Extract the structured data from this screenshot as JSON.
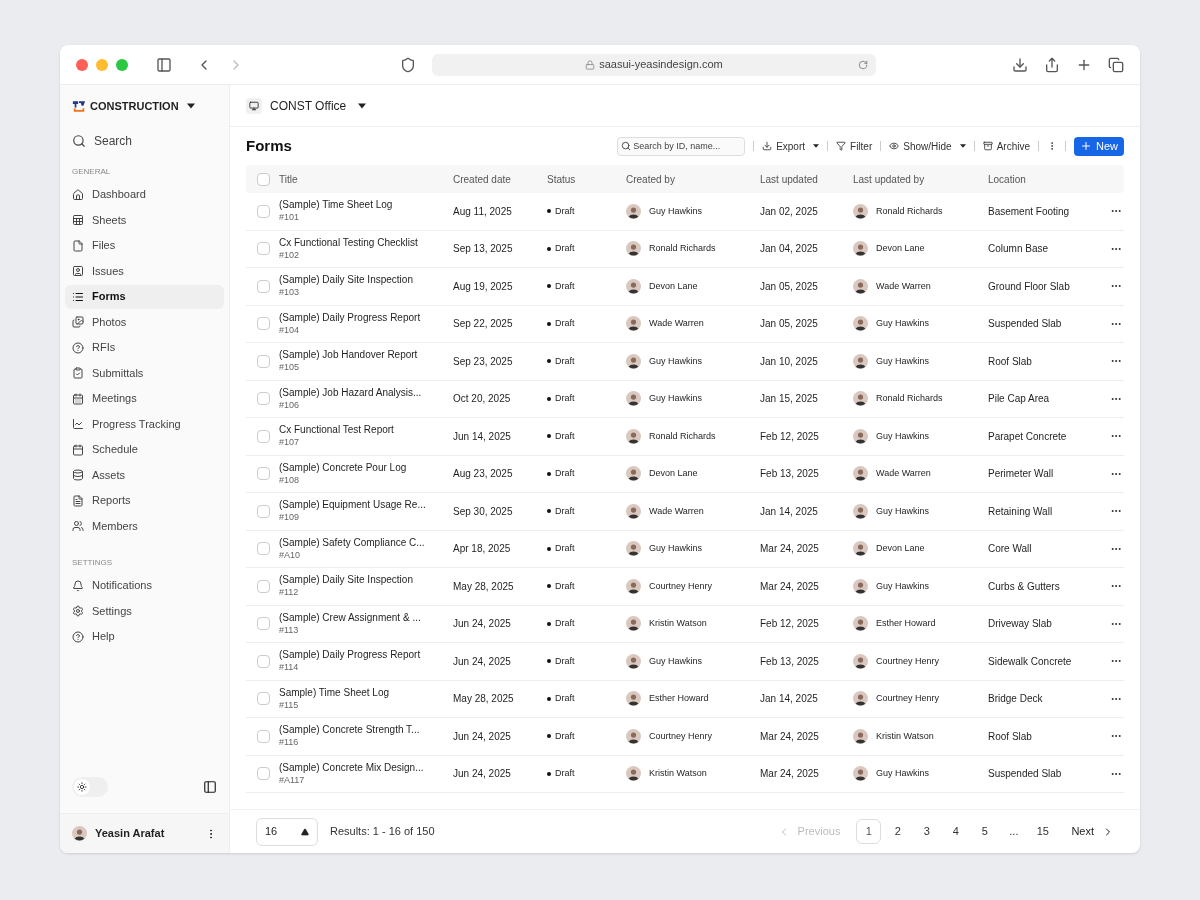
{
  "browser": {
    "url": "saasui-yeasindesign.com"
  },
  "sidebar": {
    "brand": "CONSTRUCTION",
    "search": "Search",
    "sections": [
      {
        "heading": "GENERAL",
        "items": [
          {
            "label": "Dashboard",
            "selected": false
          },
          {
            "label": "Sheets",
            "selected": false
          },
          {
            "label": "Files",
            "selected": false
          },
          {
            "label": "Issues",
            "selected": false
          },
          {
            "label": "Forms",
            "selected": true
          },
          {
            "label": "Photos",
            "selected": false
          },
          {
            "label": "RFIs",
            "selected": false
          },
          {
            "label": "Submittals",
            "selected": false
          },
          {
            "label": "Meetings",
            "selected": false
          },
          {
            "label": "Progress Tracking",
            "selected": false
          },
          {
            "label": "Schedule",
            "selected": false
          },
          {
            "label": "Assets",
            "selected": false
          },
          {
            "label": "Reports",
            "selected": false
          },
          {
            "label": "Members",
            "selected": false
          }
        ]
      },
      {
        "heading": "SETTINGS",
        "items": [
          {
            "label": "Notifications",
            "selected": false
          },
          {
            "label": "Settings",
            "selected": false
          },
          {
            "label": "Help",
            "selected": false
          }
        ]
      }
    ],
    "dark_mode": false,
    "user": "Yeasin Arafat"
  },
  "workspace": "CONST Office",
  "page_title": "Forms",
  "toolbar": {
    "search_placeholder": "Search by ID, name...",
    "export": "Export",
    "filter": "Filter",
    "show_hide": "Show/Hide",
    "archive": "Archive",
    "new": "New"
  },
  "table": {
    "all_selected": false,
    "columns": [
      "Title",
      "Created date",
      "Status",
      "Created by",
      "Last updated",
      "Last updated by",
      "Location"
    ],
    "rows": [
      {
        "title": "(Sample) Time Sheet Log",
        "id": "#101",
        "created": "Aug 11, 2025",
        "status": "Draft",
        "created_by": "Guy Hawkins",
        "updated": "Jan 02, 2025",
        "updated_by": "Ronald Richards",
        "location": "Basement Footing",
        "checked": false
      },
      {
        "title": "Cx Functional Testing Checklist",
        "id": "#102",
        "created": "Sep 13, 2025",
        "status": "Draft",
        "created_by": "Ronald Richards",
        "updated": "Jan 04, 2025",
        "updated_by": "Devon Lane",
        "location": "Column Base",
        "checked": false
      },
      {
        "title": "(Sample) Daily Site Inspection",
        "id": "#103",
        "created": "Aug 19, 2025",
        "status": "Draft",
        "created_by": "Devon Lane",
        "updated": "Jan 05, 2025",
        "updated_by": "Wade Warren",
        "location": "Ground Floor Slab",
        "checked": false
      },
      {
        "title": "(Sample) Daily Progress Report",
        "id": "#104",
        "created": "Sep 22, 2025",
        "status": "Draft",
        "created_by": "Wade Warren",
        "updated": "Jan 05, 2025",
        "updated_by": "Guy Hawkins",
        "location": "Suspended Slab",
        "checked": false
      },
      {
        "title": "(Sample) Job Handover Report",
        "id": "#105",
        "created": "Sep 23, 2025",
        "status": "Draft",
        "created_by": "Guy Hawkins",
        "updated": "Jan 10, 2025",
        "updated_by": "Guy Hawkins",
        "location": "Roof Slab",
        "checked": false
      },
      {
        "title": "(Sample) Job Hazard Analysis...",
        "id": "#106",
        "created": "Oct 20, 2025",
        "status": "Draft",
        "created_by": "Guy Hawkins",
        "updated": "Jan 15, 2025",
        "updated_by": "Ronald Richards",
        "location": "Pile Cap Area",
        "checked": false
      },
      {
        "title": "Cx Functional Test Report",
        "id": "#107",
        "created": "Jun 14, 2025",
        "status": "Draft",
        "created_by": "Ronald Richards",
        "updated": "Feb 12, 2025",
        "updated_by": "Guy Hawkins",
        "location": "Parapet Concrete",
        "checked": false
      },
      {
        "title": "(Sample) Concrete Pour Log",
        "id": "#108",
        "created": "Aug 23, 2025",
        "status": "Draft",
        "created_by": "Devon Lane",
        "updated": "Feb 13, 2025",
        "updated_by": "Wade Warren",
        "location": "Perimeter Wall",
        "checked": false
      },
      {
        "title": "(Sample) Equipment Usage Re...",
        "id": "#109",
        "created": "Sep 30, 2025",
        "status": "Draft",
        "created_by": "Wade Warren",
        "updated": "Jan 14, 2025",
        "updated_by": "Guy Hawkins",
        "location": "Retaining Wall",
        "checked": false
      },
      {
        "title": "(Sample) Safety Compliance C...",
        "id": "#A10",
        "created": "Apr 18, 2025",
        "status": "Draft",
        "created_by": "Guy Hawkins",
        "updated": "Mar 24, 2025",
        "updated_by": "Devon Lane",
        "location": "Core Wall",
        "checked": false
      },
      {
        "title": "(Sample) Daily Site Inspection",
        "id": "#112",
        "created": "May 28, 2025",
        "status": "Draft",
        "created_by": "Courtney Henry",
        "updated": "Mar 24, 2025",
        "updated_by": "Guy Hawkins",
        "location": "Curbs & Gutters",
        "checked": false
      },
      {
        "title": "(Sample) Crew Assignment & ...",
        "id": "#113",
        "created": "Jun 24, 2025",
        "status": "Draft",
        "created_by": "Kristin Watson",
        "updated": "Feb 12, 2025",
        "updated_by": "Esther Howard",
        "location": "Driveway Slab",
        "checked": false
      },
      {
        "title": "(Sample) Daily Progress Report",
        "id": "#114",
        "created": "Jun 24, 2025",
        "status": "Draft",
        "created_by": "Guy Hawkins",
        "updated": "Feb 13, 2025",
        "updated_by": "Courtney Henry",
        "location": "Sidewalk Concrete",
        "checked": false
      },
      {
        "title": "Sample) Time Sheet Log",
        "id": "#115",
        "created": "May 28, 2025",
        "status": "Draft",
        "created_by": "Esther Howard",
        "updated": "Jan 14, 2025",
        "updated_by": "Courtney Henry",
        "location": "Bridge Deck",
        "checked": false
      },
      {
        "title": "(Sample) Concrete Strength T...",
        "id": "#116",
        "created": "Jun 24, 2025",
        "status": "Draft",
        "created_by": "Courtney Henry",
        "updated": "Mar 24, 2025",
        "updated_by": "Kristin Watson",
        "location": "Roof Slab",
        "checked": false
      },
      {
        "title": "(Sample) Concrete Mix Design...",
        "id": "#A117",
        "created": "Jun 24, 2025",
        "status": "Draft",
        "created_by": "Kristin Watson",
        "updated": "Mar 24, 2025",
        "updated_by": "Guy Hawkins",
        "location": "Suspended Slab",
        "checked": false
      }
    ]
  },
  "pagination": {
    "page_size": "16",
    "results": "Results: 1 - 16 of 150",
    "previous": "Previous",
    "next": "Next",
    "pages": [
      {
        "label": "1",
        "selected": true
      },
      {
        "label": "2",
        "selected": false
      },
      {
        "label": "3",
        "selected": false
      },
      {
        "label": "4",
        "selected": false
      },
      {
        "label": "5",
        "selected": false
      },
      {
        "label": "...",
        "selected": false
      },
      {
        "label": "15",
        "selected": false
      }
    ]
  }
}
